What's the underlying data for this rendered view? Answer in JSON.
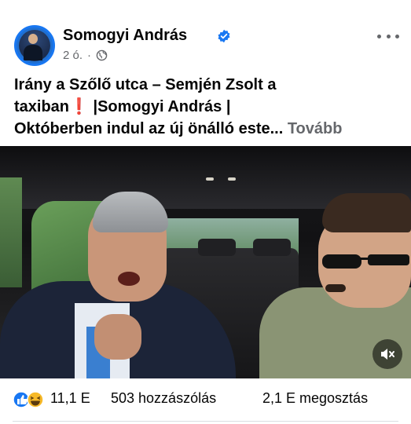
{
  "post": {
    "author": "Somogyi András",
    "time": "2 ó.",
    "dot": "·",
    "caption_line1": "Irány a Szőlő utca – Semjén Zsolt a",
    "caption_line2a": "taxiban",
    "caption_excl": "❗",
    "caption_line2b": " |Somogyi András |",
    "caption_line3": "Októberben indul az új önálló este...",
    "more_link": "Tovább"
  },
  "stats": {
    "reaction_count": "11,1 E",
    "comments": "503 hozzászólás",
    "shares": "2,1 E megosztás"
  },
  "icons": {
    "verified": "verified-badge-icon",
    "audience": "globe-icon",
    "options": "more-options-icon",
    "mute": "muted-speaker-icon",
    "like": "like-reaction-icon",
    "haha": "haha-reaction-icon"
  },
  "colors": {
    "accent": "#1877f2",
    "muted_text": "#65676b",
    "exclamation": "#e41e26"
  }
}
